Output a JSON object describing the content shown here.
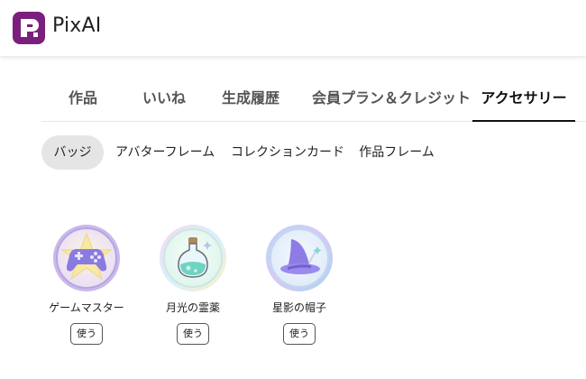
{
  "header": {
    "brand": "PixAI",
    "logo_icon": "pixai-logo-icon"
  },
  "tabs": [
    {
      "label": "作品"
    },
    {
      "label": "いいね"
    },
    {
      "label": "生成履歴"
    },
    {
      "label": "会員プラン＆クレジット"
    },
    {
      "label": "アクセサリー",
      "active": true
    }
  ],
  "subtabs": [
    {
      "label": "バッジ",
      "active": true
    },
    {
      "label": "アバターフレーム"
    },
    {
      "label": "コレクションカード"
    },
    {
      "label": "作品フレーム"
    }
  ],
  "badges": [
    {
      "name": "ゲームマスター",
      "icon": "gamepad-icon",
      "use_label": "使う"
    },
    {
      "name": "月光の霊薬",
      "icon": "potion-icon",
      "use_label": "使う"
    },
    {
      "name": "星影の帽子",
      "icon": "wizard-hat-icon",
      "use_label": "使う"
    }
  ],
  "colors": {
    "brand": "#7b1f7e",
    "active_chip_bg": "#e5e5e5"
  }
}
